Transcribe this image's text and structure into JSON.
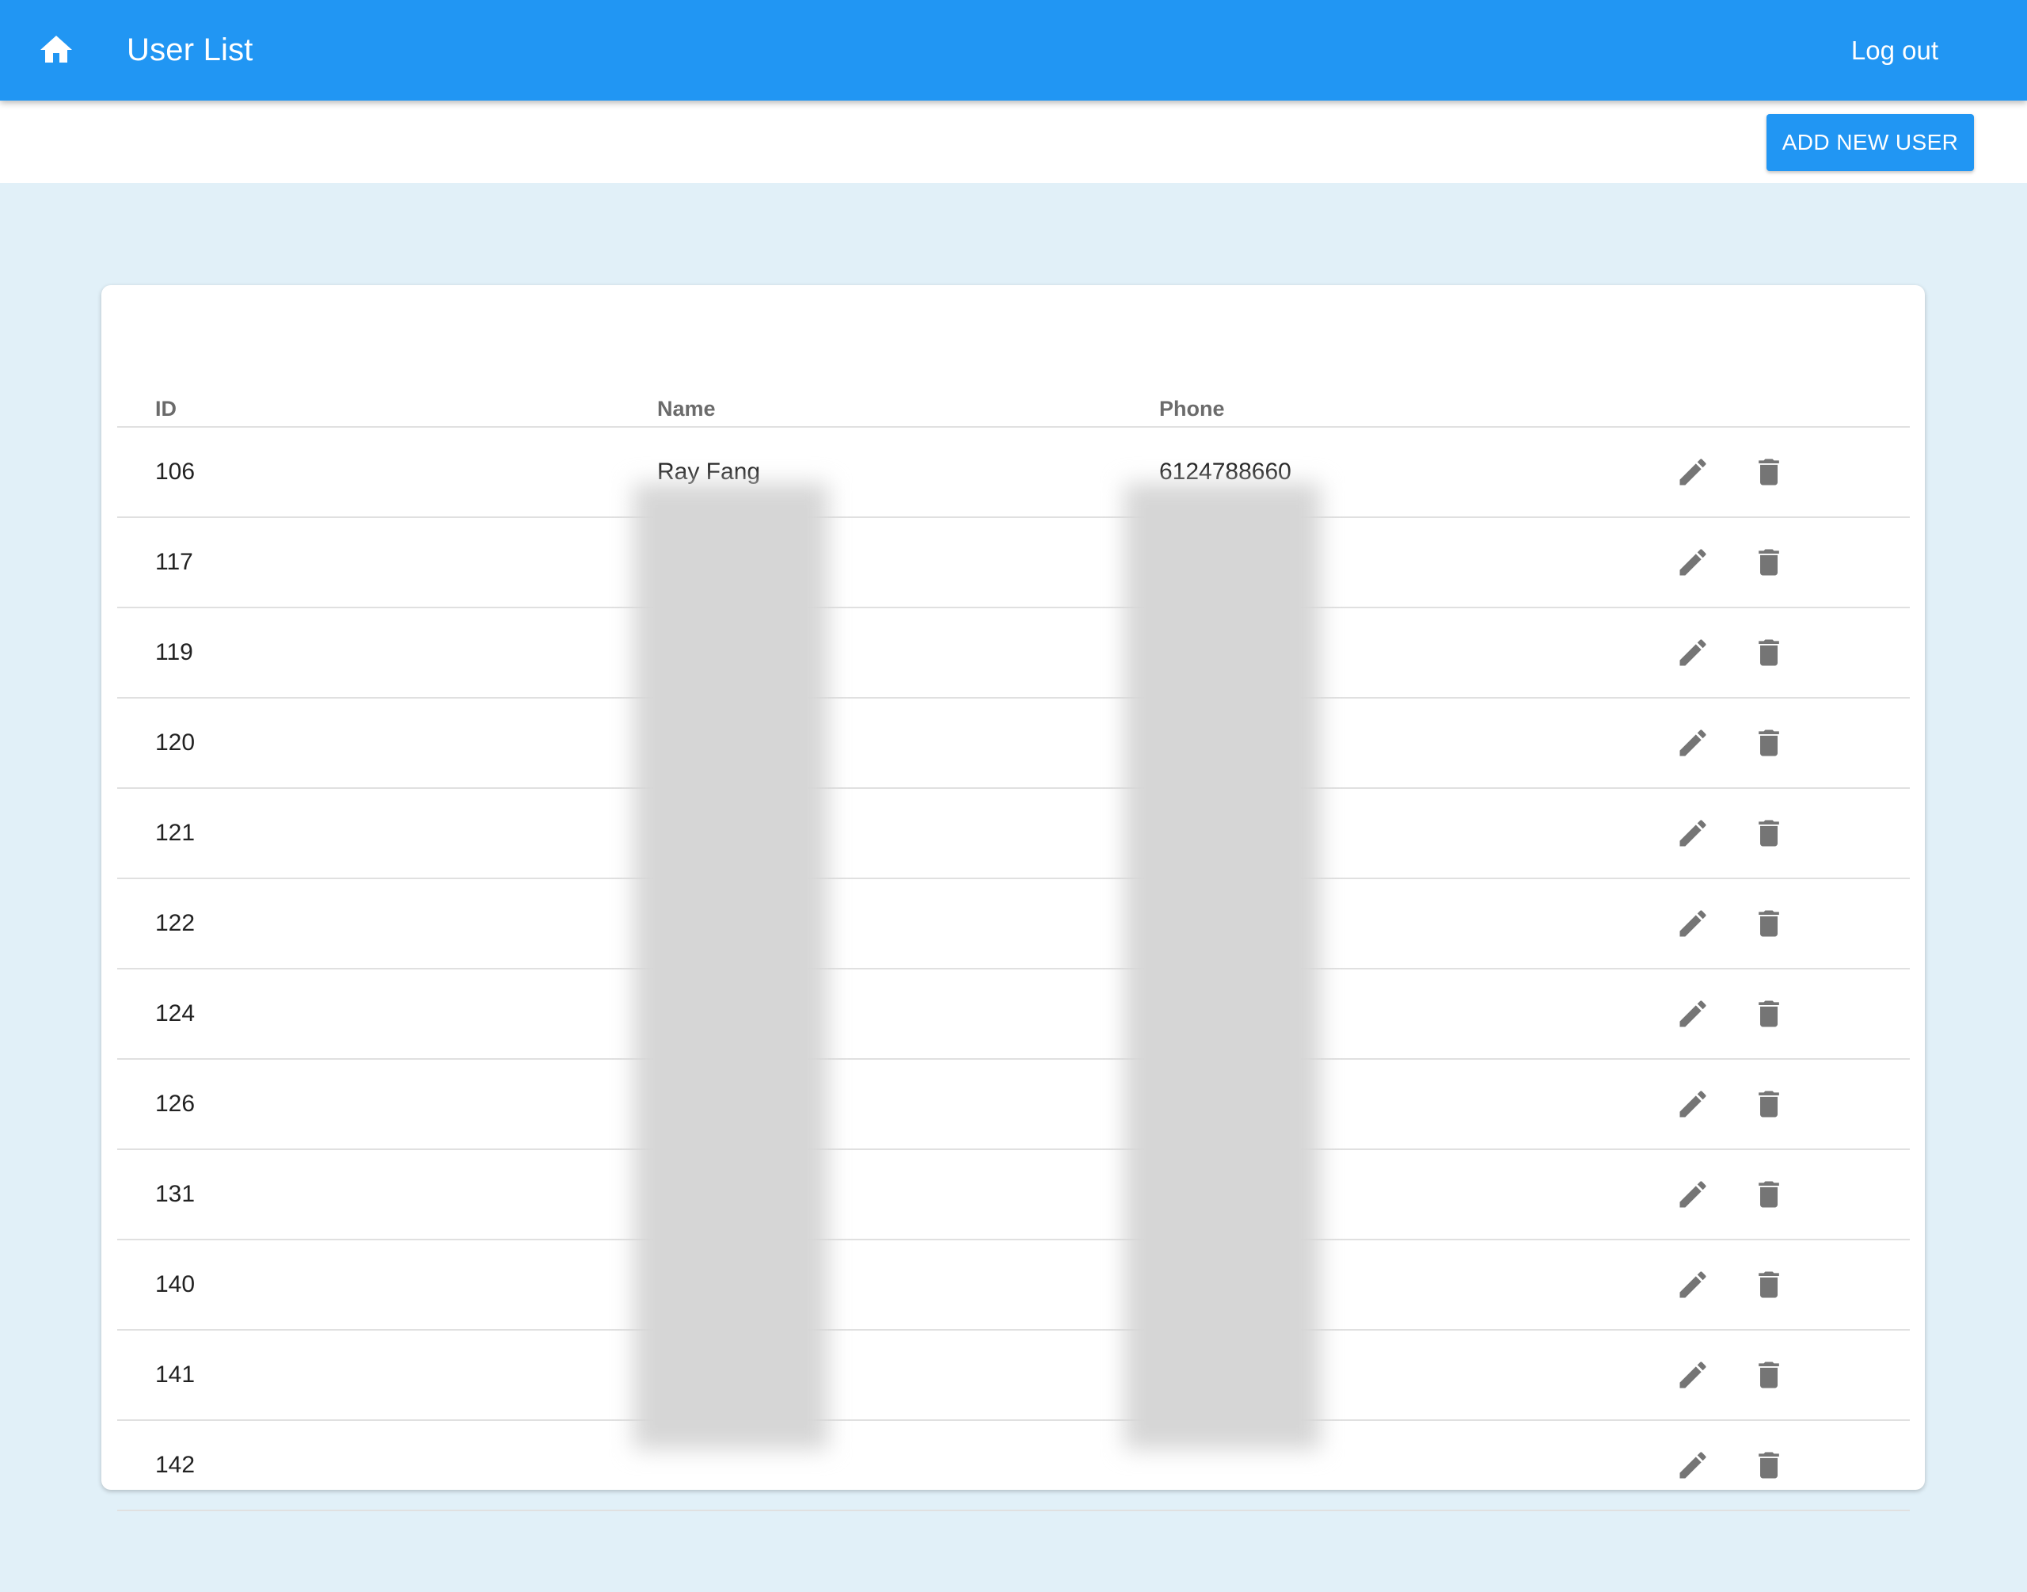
{
  "appbar": {
    "home_icon": "home-icon",
    "title": "User List",
    "logout_label": "Log out"
  },
  "toolbar": {
    "add_user_label": "ADD NEW USER"
  },
  "table": {
    "headers": {
      "id": "ID",
      "name": "Name",
      "phone": "Phone"
    },
    "rows": [
      {
        "id": "106",
        "name": "Ray Fang",
        "phone": "6124788660"
      },
      {
        "id": "117",
        "name": "",
        "phone": ""
      },
      {
        "id": "119",
        "name": "",
        "phone": ""
      },
      {
        "id": "120",
        "name": "",
        "phone": ""
      },
      {
        "id": "121",
        "name": "",
        "phone": ""
      },
      {
        "id": "122",
        "name": "",
        "phone": ""
      },
      {
        "id": "124",
        "name": "",
        "phone": ""
      },
      {
        "id": "126",
        "name": "",
        "phone": ""
      },
      {
        "id": "131",
        "name": "",
        "phone": ""
      },
      {
        "id": "140",
        "name": "",
        "phone": ""
      },
      {
        "id": "141",
        "name": "",
        "phone": ""
      },
      {
        "id": "142",
        "name": "",
        "phone": ""
      }
    ],
    "row_actions": {
      "edit_icon": "pencil-icon",
      "delete_icon": "trash-icon"
    }
  },
  "colors": {
    "primary": "#2196f3",
    "page_background": "#e1f0f8",
    "icon_gray": "#757575"
  }
}
